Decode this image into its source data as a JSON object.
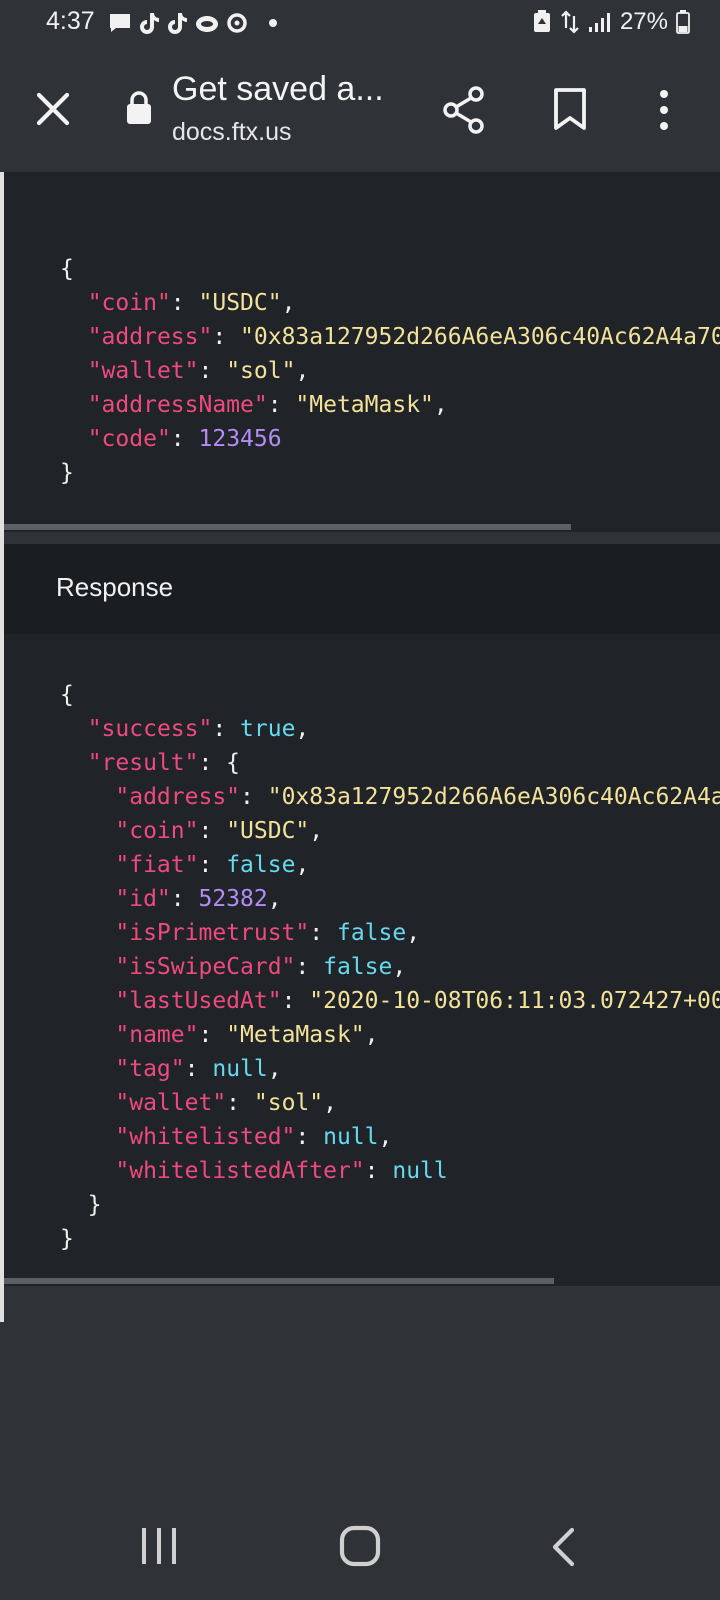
{
  "status_bar": {
    "time": "4:37",
    "battery": "27%",
    "icons_left": [
      "message-icon",
      "tiktok-icon",
      "tiktok-icon",
      "cloud-icon",
      "sync-icon",
      "dot-icon"
    ],
    "icons_right": [
      "recycle-icon",
      "data-arrows-icon",
      "signal-icon",
      "battery-icon"
    ]
  },
  "toolbar": {
    "title": "Get saved a...",
    "url": "docs.ftx.us"
  },
  "request_body": [
    {
      "key": "\"coin\"",
      "value": "\"USDC\"",
      "type": "s",
      "comma": ","
    },
    {
      "key": "\"address\"",
      "value": "\"0x83a127952d266A6eA306c40Ac62A4a70",
      "type": "s",
      "comma": ""
    },
    {
      "key": "\"wallet\"",
      "value": "\"sol\"",
      "type": "s",
      "comma": ","
    },
    {
      "key": "\"addressName\"",
      "value": "\"MetaMask\"",
      "type": "s",
      "comma": ","
    },
    {
      "key": "\"code\"",
      "value": "123456",
      "type": "n",
      "comma": ""
    }
  ],
  "response": {
    "label": "Response",
    "top": [
      {
        "key": "\"success\"",
        "value": "true",
        "type": "b",
        "comma": ","
      }
    ],
    "result_key": "\"result\"",
    "result": [
      {
        "key": "\"address\"",
        "value": "\"0x83a127952d266A6eA306c40Ac62A4a7",
        "type": "s",
        "comma": ""
      },
      {
        "key": "\"coin\"",
        "value": "\"USDC\"",
        "type": "s",
        "comma": ","
      },
      {
        "key": "\"fiat\"",
        "value": "false",
        "type": "b",
        "comma": ","
      },
      {
        "key": "\"id\"",
        "value": "52382",
        "type": "n",
        "comma": ","
      },
      {
        "key": "\"isPrimetrust\"",
        "value": "false",
        "type": "b",
        "comma": ","
      },
      {
        "key": "\"isSwipeCard\"",
        "value": "false",
        "type": "b",
        "comma": ","
      },
      {
        "key": "\"lastUsedAt\"",
        "value": "\"2020-10-08T06:11:03.072427+00",
        "type": "s",
        "comma": ""
      },
      {
        "key": "\"name\"",
        "value": "\"MetaMask\"",
        "type": "s",
        "comma": ","
      },
      {
        "key": "\"tag\"",
        "value": "null",
        "type": "b",
        "comma": ","
      },
      {
        "key": "\"wallet\"",
        "value": "\"sol\"",
        "type": "s",
        "comma": ","
      },
      {
        "key": "\"whitelisted\"",
        "value": "null",
        "type": "b",
        "comma": ","
      },
      {
        "key": "\"whitelistedAfter\"",
        "value": "null",
        "type": "b",
        "comma": ""
      }
    ]
  },
  "nav": {
    "icons": [
      "recents-icon",
      "home-icon",
      "back-icon"
    ]
  }
}
